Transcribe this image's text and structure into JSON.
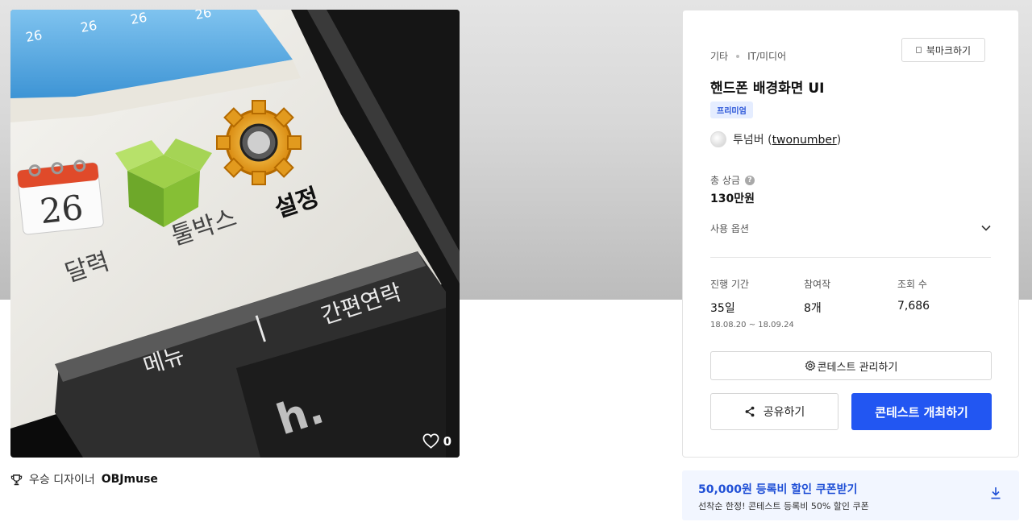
{
  "artwork": {
    "image_texts": {
      "calendar_day": "26",
      "calendar_label": "달력",
      "toolbox_label": "툴박스",
      "settings_label": "설정",
      "menu_label": "메뉴",
      "contacts_label": "간편연락",
      "separator": "|",
      "logo": "h.",
      "weather": [
        "26",
        "26",
        "26",
        "26"
      ]
    },
    "like_count": "0",
    "icons": {
      "like": "heart-icon"
    }
  },
  "award": {
    "prefix": "우승 디자이너",
    "designer": "OBJmuse",
    "icon": "trophy-icon"
  },
  "contest": {
    "breadcrumb": [
      "기타",
      "IT/미디어"
    ],
    "bookmark_label": "북마크하기",
    "title": "핸드폰 배경화면 UI",
    "badge": "프리미엄",
    "host_name": "투넘버",
    "host_handle": "twonumber",
    "prize_label": "총 상금",
    "prize_help": "?",
    "prize_value": "130만원",
    "usage_label": "사용 옵션",
    "stats": [
      {
        "label": "진행 기간",
        "value": "35일",
        "sub": "18.08.20 ~ 18.09.24"
      },
      {
        "label": "참여작",
        "value": "8개"
      },
      {
        "label": "조회 수",
        "value": "7,686"
      }
    ],
    "manage_label": "콘테스트 관리하기",
    "share_label": "공유하기",
    "host_contest_label": "콘테스트 개최하기"
  },
  "coupon": {
    "title": "50,000원 등록비 할인 쿠폰받기",
    "subtitle": "선착순 한정! 콘테스트 등록비 50% 할인 쿠폰",
    "icon": "download-icon"
  },
  "colors": {
    "accent": "#2256f2",
    "badge_bg": "#e5edff",
    "coupon_bg": "#f2f6ff"
  }
}
